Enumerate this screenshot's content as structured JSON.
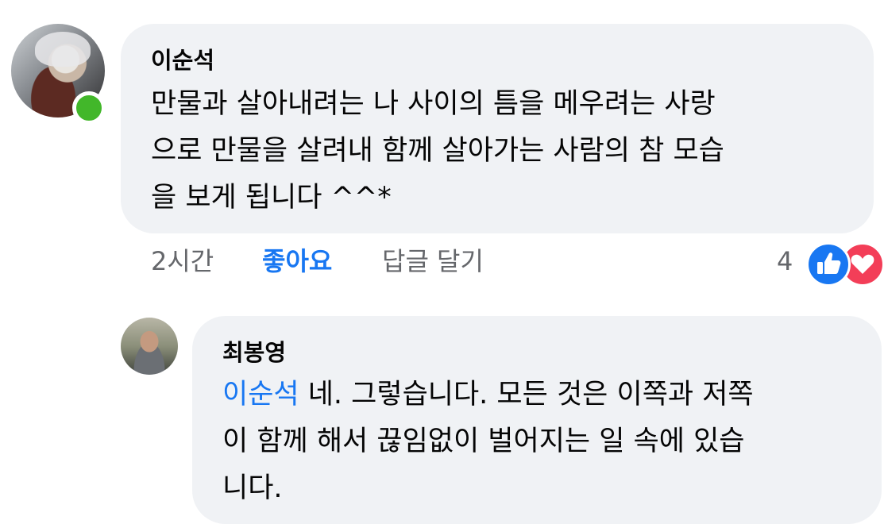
{
  "comments": [
    {
      "author": "이순석",
      "lines": [
        "만물과 살아내려는 나 사이의 틈을 메우려는 사랑",
        "으로  만물을 살려내 함께 살아가는 사람의 참 모습",
        "을 보게 됩니다 ^^*"
      ],
      "online": true,
      "time": "2시간",
      "like_label": "좋아요",
      "reply_label": "답글 달기",
      "reaction_count": "4",
      "reactions": [
        "like-icon",
        "love-icon"
      ]
    },
    {
      "author": "최봉영",
      "mention": "이순석",
      "lines": [
        " 네. 그렇습니다. 모든 것은 이쪽과 저쪽",
        "이 함께 해서 끊임없이 벌어지는 일 속에 있습",
        "니다."
      ]
    }
  ],
  "colors": {
    "bubble": "#f0f2f5",
    "link": "#1877f2",
    "meta": "#65676b",
    "online": "#42b72a",
    "like": "#1877f2",
    "love": "#f33e58"
  }
}
